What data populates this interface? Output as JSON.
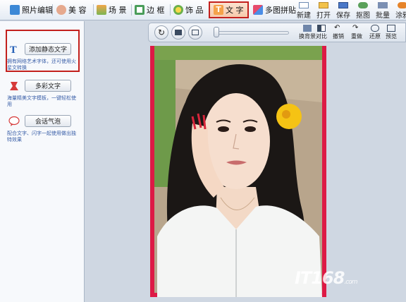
{
  "menu": {
    "tabs": [
      {
        "label": "照片编辑",
        "icon": "photo-edit-icon"
      },
      {
        "label": "美 容",
        "icon": "beauty-icon"
      },
      {
        "label": "场 景",
        "icon": "scene-icon"
      },
      {
        "label": "边 框",
        "icon": "frame-icon"
      },
      {
        "label": "饰 品",
        "icon": "accessory-icon"
      },
      {
        "label": "文 字",
        "icon": "text-icon"
      },
      {
        "label": "多图拼贴",
        "icon": "collage-icon"
      }
    ],
    "tools": [
      "新建",
      "打开",
      "保存",
      "抠图",
      "批量",
      "涂鸦"
    ]
  },
  "left_panel": {
    "items": [
      {
        "button": "添加静态文字",
        "desc": "拥有网络艺术字体，还可使用火星文转换",
        "icon": "static-text-icon"
      },
      {
        "button": "多彩文字",
        "desc": "海量精美文字模板，一键轻松使用",
        "icon": "colorful-text-icon"
      },
      {
        "button": "会话气泡",
        "desc": "配合文字、闪字一起使用做出独特效果",
        "icon": "speech-bubble-icon"
      }
    ]
  },
  "right_toolbar": {
    "tools": [
      "换背景",
      "对比",
      "撤销",
      "重做",
      "还原",
      "预览"
    ]
  },
  "canvas": {
    "watermark": "IT168",
    "watermark_suffix": ".com"
  },
  "colors": {
    "accent_red": "#c3201d",
    "photo_bg": "#dd1a45",
    "link_blue": "#3a5fa8"
  }
}
